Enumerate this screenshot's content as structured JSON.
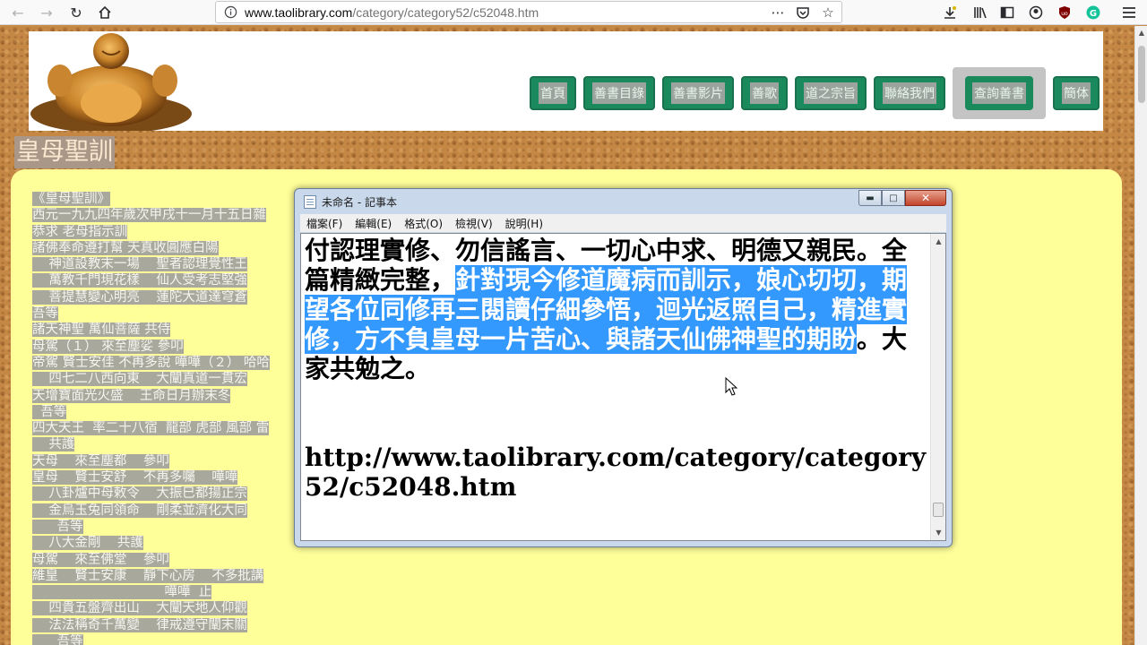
{
  "browser": {
    "url_host": "www.taolibrary.com",
    "url_path": "/category/category52/c52048.htm",
    "nav_icons": [
      "back-icon",
      "forward-icon",
      "reload-icon",
      "home-icon"
    ],
    "url_action_icons": [
      "more-icon",
      "pocket-icon",
      "bookmark-star-icon"
    ],
    "right_icons": [
      "download-icon",
      "library-icon",
      "sidebar-icon",
      "account-icon",
      "ublock-icon",
      "grammarly-icon",
      "menu-icon"
    ]
  },
  "site": {
    "nav": [
      {
        "label": "首頁",
        "active": false
      },
      {
        "label": "善書目錄",
        "active": false
      },
      {
        "label": "善書影片",
        "active": false
      },
      {
        "label": "善歌",
        "active": false
      },
      {
        "label": "道之宗旨",
        "active": false
      },
      {
        "label": "聯絡我們",
        "active": false
      },
      {
        "label": "查詢善書",
        "active": true
      },
      {
        "label": "簡体",
        "active": false
      }
    ],
    "page_title": "皇母聖訓",
    "scripture_lines": [
      "《皇母聖訓》",
      "西元一九九四年歲次甲戌十一月十五日雜",
      "恭求 老母指示訓",
      "諸佛奉命遵打幫 天真收圓應白陽",
      "    神道設教末一場    聖者認理覺性王",
      "    萬教千門現花樣    仙人受考志堅強",
      "    菩提慧變心明亮    蓮陀大道達穹蒼",
      "吾等",
      "諸天神聖 萬仙菩薩 共侍",
      "母駕（１） 來至塵娑 參叩",
      "帝駕 賢士安佳 不再多說 嘩嘩（２） 哈哈",
      "    四七二八西向東    大闡真道一貫宏",
      "天增寶面光火盛    王命日月辦末冬",
      "  吾等",
      "四大天王  率二十八宿  龍部 虎部 風部 雷",
      "    共護",
      "天母    來至塵都    參叩",
      "皇母    賢士安舒    不再多囑    嘩嘩",
      "    八卦爐中母敕令    大振巳都揚正宗",
      "    金烏玉兔同領命    剛柔並濟化大同",
      "      吾等",
      "    八大金剛    共護",
      "母駕    來至佛堂    參叩",
      "維皇    賢士安康    靜下心房    不多批講",
      "                                嘩嘩  止",
      "    四貴五盤齊出山    大闡天地人仰觀",
      "    法法稱奇千萬變    律戒遵守闡末關",
      "      吾等"
    ]
  },
  "notepad": {
    "title": "未命名 - 記事本",
    "menus": [
      "檔案(F)",
      "編輯(E)",
      "格式(O)",
      "檢視(V)",
      "說明(H)"
    ],
    "text_before": "付認理實修、勿信謠言、一切心中求、明德又親民。全篇精緻完整，",
    "text_selected": "針對現今修道魔病而訓示，娘心切切，期望各位同修再三閱讀仔細參悟，迴光返照自己，精進實修，方不負皇母一片苦心、與諸天仙佛神聖的期盼",
    "text_after": "。大家共勉之。",
    "url_line": "http://www.taolibrary.com/category/category52/c52048.htm"
  }
}
